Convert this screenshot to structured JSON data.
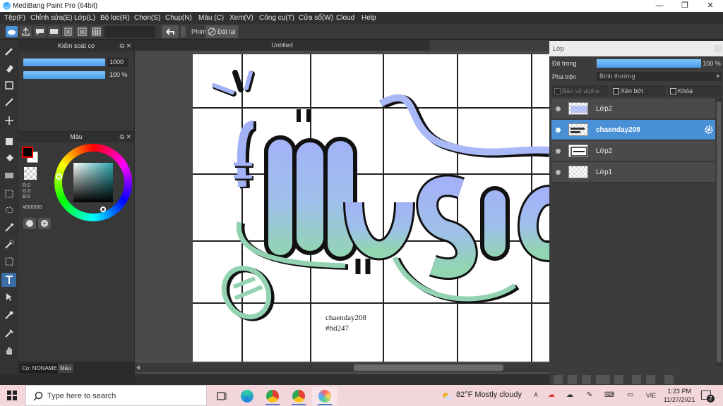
{
  "window": {
    "title": "MediBang Paint Pro (64bit)",
    "controls": [
      "—",
      "❐",
      "✕"
    ]
  },
  "menu": [
    "Tệp(F)",
    "Chỉnh sửa(E)",
    "Lớp(L)",
    "Bộ lọc(R)",
    "Chọn(S)",
    "Chụp(N)",
    "Màu (C)",
    "Xem(V)",
    "Công cụ(T)",
    "Cửa sổ(W)",
    "Cloud",
    "Help"
  ],
  "toolbar": {
    "phim_label": "Phím",
    "reset_label": "Đặt lại"
  },
  "brush_panel": {
    "title": "Kiểm soát cọ",
    "size_value": "1000",
    "opacity_value": "100 %"
  },
  "color_panel": {
    "title": "Màu",
    "r": "R:0",
    "g": "G:0",
    "b": "B:0",
    "hex": "#000000",
    "fg_color": "#000000",
    "bg_color": "#ffffff"
  },
  "bottom_tabs": [
    "Cọ: NONAME",
    "Màu"
  ],
  "canvas": {
    "tab_title": "Untitled",
    "artwork_text": "Music",
    "signature_line1": "chaenday208",
    "signature_line2": "#hd247"
  },
  "layer_panel": {
    "title": "Lớp",
    "opacity_label": "Độ trong",
    "opacity_value": "100 %",
    "blend_label": "Pha trộn",
    "blend_value": "Bình thường",
    "protect_alpha": "Bảo vệ alpha",
    "clipping": "Xén bớt",
    "lock": "Khóa",
    "layers": [
      {
        "name": "Lớp2",
        "selected": false
      },
      {
        "name": "chaenday208",
        "selected": true
      },
      {
        "name": "Lớp2",
        "selected": false
      },
      {
        "name": "Lớp1",
        "selected": false
      }
    ]
  },
  "taskbar": {
    "search_placeholder": "Type here to search",
    "weather": "82°F  Mostly cloudy",
    "language": "VIE",
    "time": "1:23 PM",
    "date": "11/27/2021",
    "notification_count": "2"
  },
  "colors": {
    "accent": "#4a90d6",
    "artwork_gradient_top": "#9fb6f5",
    "artwork_gradient_bottom": "#93d3b2",
    "taskbar_bg": "#f3d6dc"
  }
}
